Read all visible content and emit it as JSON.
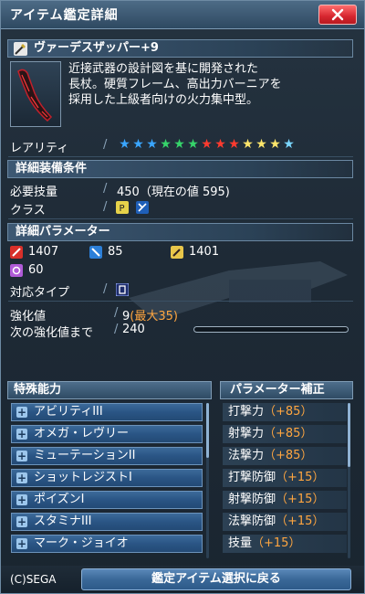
{
  "window": {
    "title": "アイテム鑑定詳細"
  },
  "item": {
    "name": "ヴァーデスザッパー+9",
    "description_lines": [
      "近接武器の設計図を基に開発された",
      "長杖。硬質フレーム、高出力バーニアを",
      "採用した上級者向けの火力集中型。"
    ],
    "rarity_label": "レアリティ",
    "rarity_star_colors": [
      "#3aa6ff",
      "#3aa6ff",
      "#3aa6ff",
      "#36d46a",
      "#36d46a",
      "#36d46a",
      "#ff3b2f",
      "#ff3b2f",
      "#ff3b2f",
      "#ffe66b",
      "#ffe66b",
      "#ffe66b",
      "#7ad7ff"
    ]
  },
  "requirements": {
    "header": "詳細装備条件",
    "skill_label": "必要技量",
    "skill_value": "450（現在の値 595)",
    "class_label": "クラス",
    "class_icons": [
      "phantom-class-icon",
      "hero-class-icon"
    ]
  },
  "params": {
    "header": "詳細パラメーター",
    "melee": "1407",
    "ranged": "85",
    "tech": "1401",
    "pp": "60",
    "type_label": "対応タイプ",
    "type_icon": "rod-type-icon"
  },
  "enhance": {
    "label": "強化値",
    "value": "9",
    "max": "(最大35)",
    "next_label": "次の強化値まで",
    "next_value": "240",
    "progress": 0.0
  },
  "abilities": {
    "header": "特殊能力",
    "items": [
      "アビリティIII",
      "オメガ・レヴリー",
      "ミューテーションII",
      "ショットレジストI",
      "ポイズンI",
      "スタミナIII",
      "マーク・ジョイオ"
    ]
  },
  "param_bonus": {
    "header": "パラメーター補正",
    "items": [
      {
        "name": "打撃力",
        "value": "（+85）"
      },
      {
        "name": "射撃力",
        "value": "（+85）"
      },
      {
        "name": "法撃力",
        "value": "（+85）"
      },
      {
        "name": "打撃防御",
        "value": "（+15）"
      },
      {
        "name": "射撃防御",
        "value": "（+15）"
      },
      {
        "name": "法撃防御",
        "value": "（+15）"
      },
      {
        "name": "技量",
        "value": "（+15）"
      }
    ]
  },
  "footer": {
    "copyright": "(C)SEGA",
    "back_button": "鑑定アイテム選択に戻る"
  },
  "colors": {
    "accent_orange": "#ffa640",
    "list_blue": "#2a5585"
  }
}
